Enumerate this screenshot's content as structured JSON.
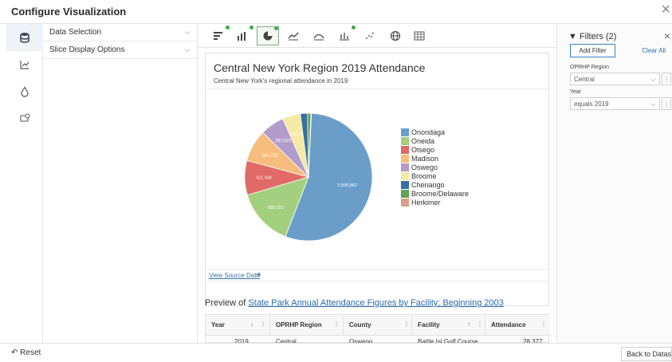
{
  "window": {
    "title": "Configure Visualization",
    "close_icon": "×"
  },
  "accordion": {
    "items": [
      {
        "label": "Data Selection",
        "chevron": "⌵"
      },
      {
        "label": "Slice Display Options",
        "chevron": "⌵"
      }
    ]
  },
  "chart_card": {
    "title": "Central New York Region 2019 Attendance",
    "subtitle": "Central New York's regional attendance in 2019",
    "view_source": "View Source Data"
  },
  "chart_data": {
    "type": "pie",
    "title": "Central New York Region 2019 Attendance",
    "subtitle": "Central New York's regional attendance in 2019",
    "legend_position": "right",
    "slices": [
      {
        "label": "Onondaga",
        "value": 2595882,
        "value_label": "2,595,882",
        "color": "#6a9ec9"
      },
      {
        "label": "Oneida",
        "value": 685021,
        "value_label": "685,021",
        "color": "#a3d07f"
      },
      {
        "label": "Otsego",
        "value": 411448,
        "value_label": "411,448",
        "color": "#e06b66"
      },
      {
        "label": "Madison",
        "value": 381728,
        "value_label": "381,728",
        "color": "#f6bd7c"
      },
      {
        "label": "Oswego",
        "value": 287623,
        "value_label": "287,623",
        "color": "#b39bcc"
      },
      {
        "label": "Broome",
        "value": 214483,
        "value_label": "214,48",
        "color": "#f4eaa6"
      },
      {
        "label": "Chenango",
        "value": 85000,
        "value_label": "",
        "color": "#38709e"
      },
      {
        "label": "Broome/Delaware",
        "value": 40000,
        "value_label": "",
        "color": "#5fa450"
      },
      {
        "label": "Herkimer",
        "value": 5000,
        "value_label": "",
        "color": "#d8a08a"
      }
    ]
  },
  "preview": {
    "prefix": "Preview of ",
    "link": "State Park Annual Attendance Figures by Facility: Beginning 2003"
  },
  "table": {
    "columns": [
      {
        "label": "Year",
        "sort": "↓"
      },
      {
        "label": "OPRHP Region",
        "sort": ""
      },
      {
        "label": "County",
        "sort": ""
      },
      {
        "label": "Facility",
        "sort": "↑"
      },
      {
        "label": "Attendance",
        "sort": ""
      }
    ],
    "column_menu": "⋮",
    "rows": [
      [
        "2019",
        "Central",
        "Oswego",
        "Battle Isl Golf Course",
        "28,377"
      ]
    ]
  },
  "filters": {
    "title": "Filters (2)",
    "close": "×",
    "add_filter": "Add Filter",
    "clear_all": "Clear All",
    "items": [
      {
        "label": "OPRHP Region",
        "value": "Central"
      },
      {
        "label": "Year",
        "value": "equals 2019"
      }
    ],
    "menu_glyph": "⋮",
    "chevron": "⌵"
  },
  "bottom": {
    "reset": "Reset",
    "reset_icon": "↶",
    "back": "Back to Dataset"
  },
  "icons": {
    "rail": [
      "database-icon",
      "axes-chart-icon",
      "droplet-icon",
      "comment-icon"
    ],
    "chart_types": [
      "bar-horizontal-icon",
      "column-chart-icon",
      "pie-chart-icon",
      "line-chart-icon",
      "area-chart-icon",
      "timeline-icon",
      "scatter-icon",
      "map-globe-icon",
      "table-icon"
    ]
  },
  "colors": {
    "accent": "#3b82c4",
    "active_green": "#3caa50",
    "link": "#2a6db0"
  }
}
